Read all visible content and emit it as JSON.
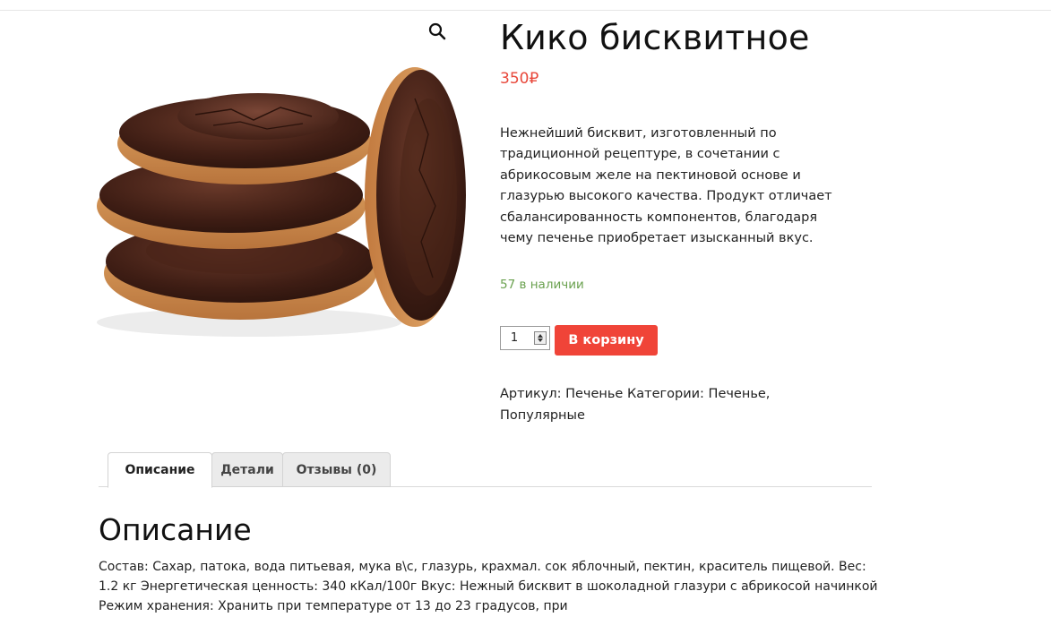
{
  "product": {
    "title": "Кико бисквитное",
    "price": "350₽",
    "short_description": "Нежнейший бисквит, изготовленный по традиционной рецептуре, в сочетании с абрикосовым желе на пектиновой основе и глазурью высокого качества. Продукт отличает сбалансированность компонентов, благодаря чему печенье приобретает изысканный вкус.",
    "stock": "57 в наличии",
    "quantity": "1",
    "add_to_cart": "В корзину",
    "meta": "Артикул: Печенье Категории: Печенье, Популярные",
    "image_icon": "zoom-icon"
  },
  "tabs": [
    {
      "label": "Описание",
      "active": true
    },
    {
      "label": "Детали",
      "active": false
    },
    {
      "label": "Отзывы (0)",
      "active": false
    }
  ],
  "panel": {
    "title": "Описание",
    "text": "Состав: Сахар, патока, вода питьевая, мука в\\с, глазурь, крахмал. сок яблочный, пектин, краситель пищевой. Вес: 1.2 кг Энергетическая ценность: 340 кКал/100г Вкус: Нежный бисквит в шоколадной глазури с абрикосой начинкой Режим хранения: Хранить при температуре от 13 до 23 градусов, при"
  },
  "colors": {
    "price": "#e8473a",
    "stock": "#6aa14f",
    "button": "#f04438"
  }
}
